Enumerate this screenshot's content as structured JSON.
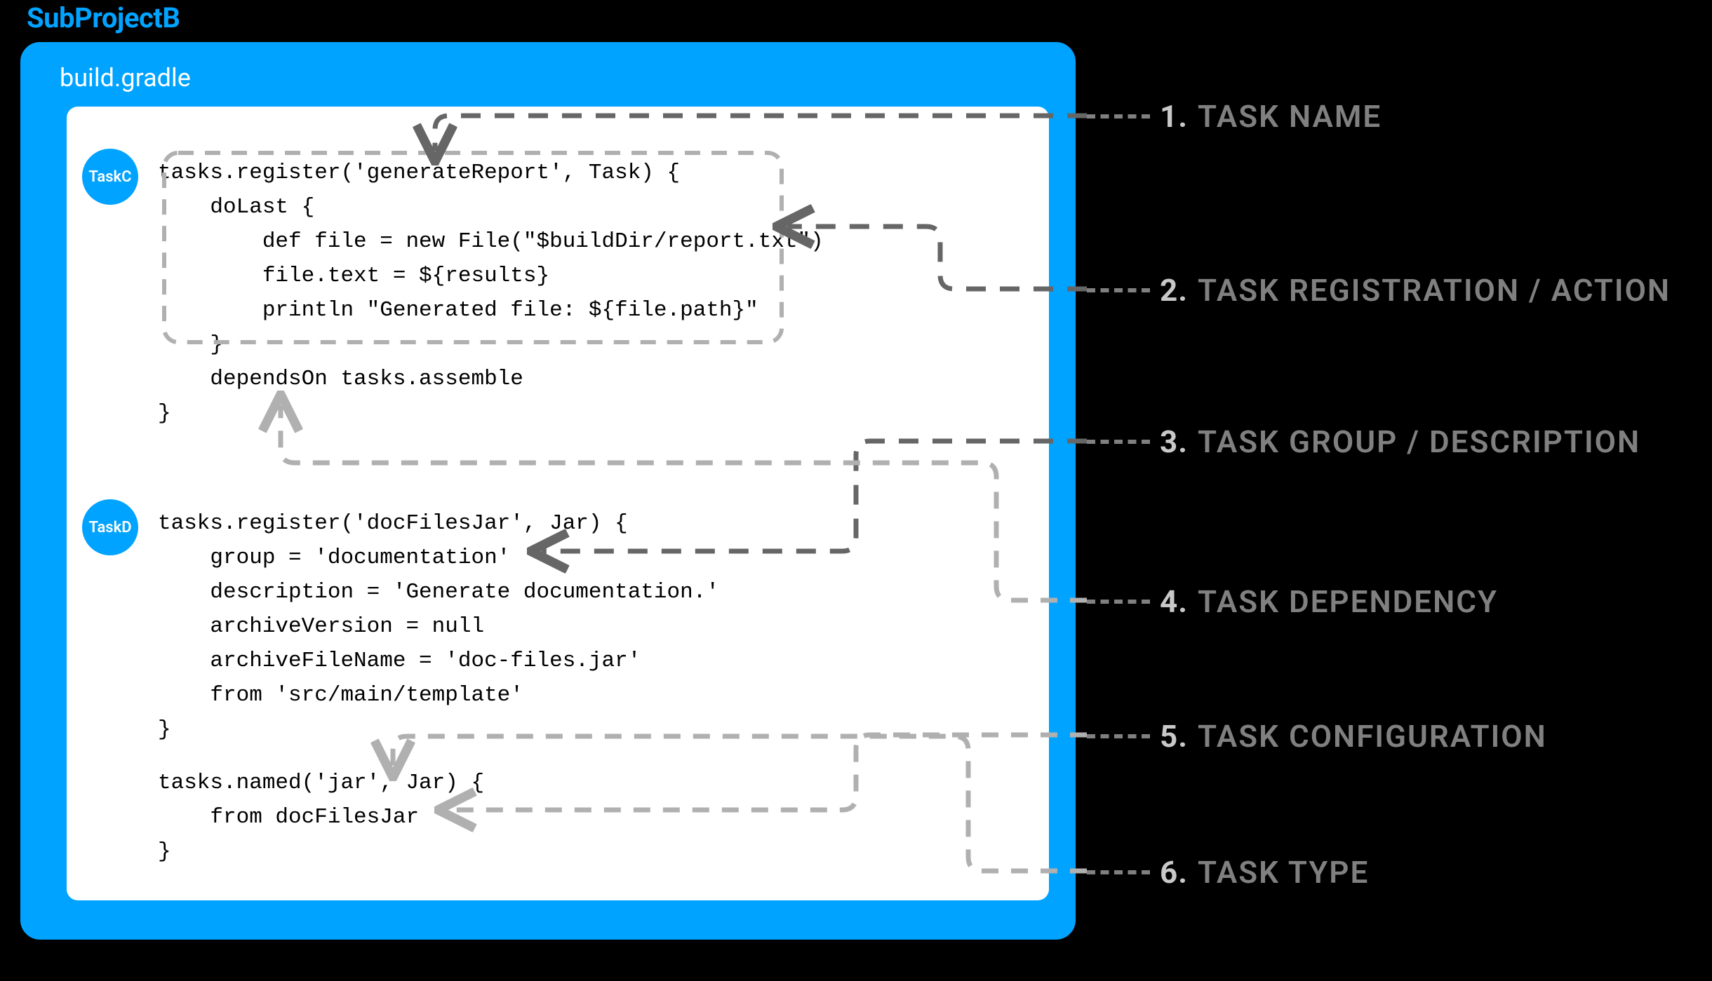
{
  "project": {
    "title": "SubProjectB"
  },
  "frame": {
    "filename": "build.gradle"
  },
  "tasks": {
    "c": {
      "chip": "TaskC"
    },
    "d": {
      "chip": "TaskD"
    }
  },
  "code": {
    "block1": "tasks.register('generateReport', Task) {\n    doLast {\n        def file = new File(\"$buildDir/report.txt\")\n        file.text = ${results}\n        println \"Generated file: ${file.path}\"\n    }\n    dependsOn tasks.assemble\n}",
    "block2": "tasks.register('docFilesJar', Jar) {\n    group = 'documentation'\n    description = 'Generate documentation.'\n    archiveVersion = null\n    archiveFileName = 'doc-files.jar'\n    from 'src/main/template'\n}",
    "block3": "tasks.named('jar', Jar) {\n    from docFilesJar\n}"
  },
  "callouts": [
    {
      "num": "1.",
      "label": "TASK NAME"
    },
    {
      "num": "2.",
      "label": "TASK REGISTRATION / ACTION"
    },
    {
      "num": "3.",
      "label": "TASK GROUP / DESCRIPTION"
    },
    {
      "num": "4.",
      "label": "TASK DEPENDENCY"
    },
    {
      "num": "5.",
      "label": "TASK CONFIGURATION"
    },
    {
      "num": "6.",
      "label": "TASK TYPE"
    }
  ],
  "colors": {
    "accent": "#00A3FF",
    "callout_num": "#c8c8c8",
    "callout_label": "#808080",
    "connector_dark": "#666666",
    "connector_light": "#b0b0b0"
  }
}
